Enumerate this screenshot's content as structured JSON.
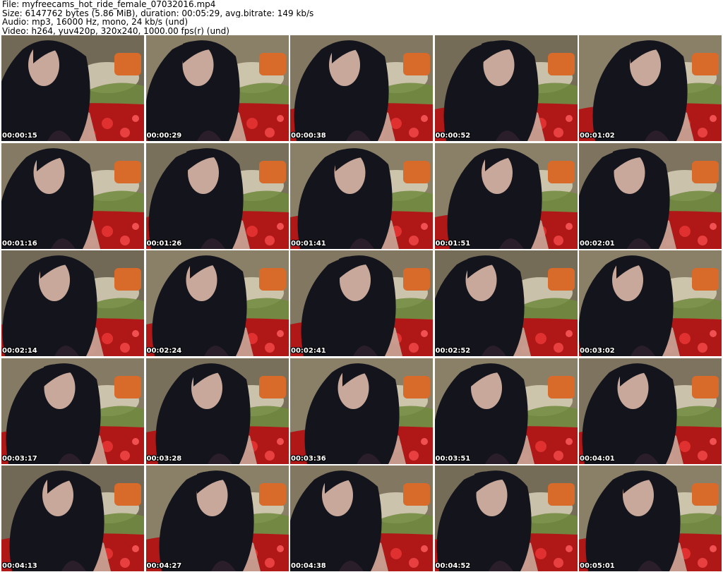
{
  "header": {
    "file_line": "File: myfreecams_hot_ride_female_07032016.mp4",
    "size_line": "Size: 6147762 bytes (5.86 MiB), duration: 00:05:29, avg.bitrate: 149 kb/s",
    "audio_line": "Audio: mp3, 16000 Hz, mono, 24 kb/s (und)",
    "video_line": "Video: h264, yuv420p, 320x240, 1000.00 fps(r) (und)"
  },
  "thumbnails": [
    {
      "timestamp": "00:00:15",
      "scene": "webcam-frame"
    },
    {
      "timestamp": "00:00:29",
      "scene": "webcam-frame"
    },
    {
      "timestamp": "00:00:38",
      "scene": "webcam-frame"
    },
    {
      "timestamp": "00:00:52",
      "scene": "webcam-frame"
    },
    {
      "timestamp": "00:01:02",
      "scene": "webcam-frame"
    },
    {
      "timestamp": "00:01:16",
      "scene": "webcam-frame"
    },
    {
      "timestamp": "00:01:26",
      "scene": "webcam-frame"
    },
    {
      "timestamp": "00:01:41",
      "scene": "webcam-frame"
    },
    {
      "timestamp": "00:01:51",
      "scene": "webcam-frame"
    },
    {
      "timestamp": "00:02:01",
      "scene": "webcam-frame"
    },
    {
      "timestamp": "00:02:14",
      "scene": "webcam-frame"
    },
    {
      "timestamp": "00:02:24",
      "scene": "webcam-frame"
    },
    {
      "timestamp": "00:02:41",
      "scene": "webcam-frame"
    },
    {
      "timestamp": "00:02:52",
      "scene": "webcam-frame"
    },
    {
      "timestamp": "00:03:02",
      "scene": "webcam-frame"
    },
    {
      "timestamp": "00:03:17",
      "scene": "webcam-frame"
    },
    {
      "timestamp": "00:03:28",
      "scene": "webcam-frame"
    },
    {
      "timestamp": "00:03:36",
      "scene": "webcam-frame"
    },
    {
      "timestamp": "00:03:51",
      "scene": "webcam-frame"
    },
    {
      "timestamp": "00:04:01",
      "scene": "webcam-frame"
    },
    {
      "timestamp": "00:04:13",
      "scene": "webcam-frame"
    },
    {
      "timestamp": "00:04:27",
      "scene": "webcam-frame"
    },
    {
      "timestamp": "00:04:38",
      "scene": "webcam-frame"
    },
    {
      "timestamp": "00:04:52",
      "scene": "webcam-frame"
    },
    {
      "timestamp": "00:05:01",
      "scene": "webcam-frame"
    }
  ],
  "colors": {
    "wall": "#8a8068",
    "cushion_cream": "#d8d0b8",
    "pillow_orange": "#d86a2a",
    "blanket_green": "#6e8a3c",
    "floral_red": "#b01818",
    "hair": "#14141c",
    "skin": "#c8a89a",
    "dress": "#2a1e2a"
  }
}
